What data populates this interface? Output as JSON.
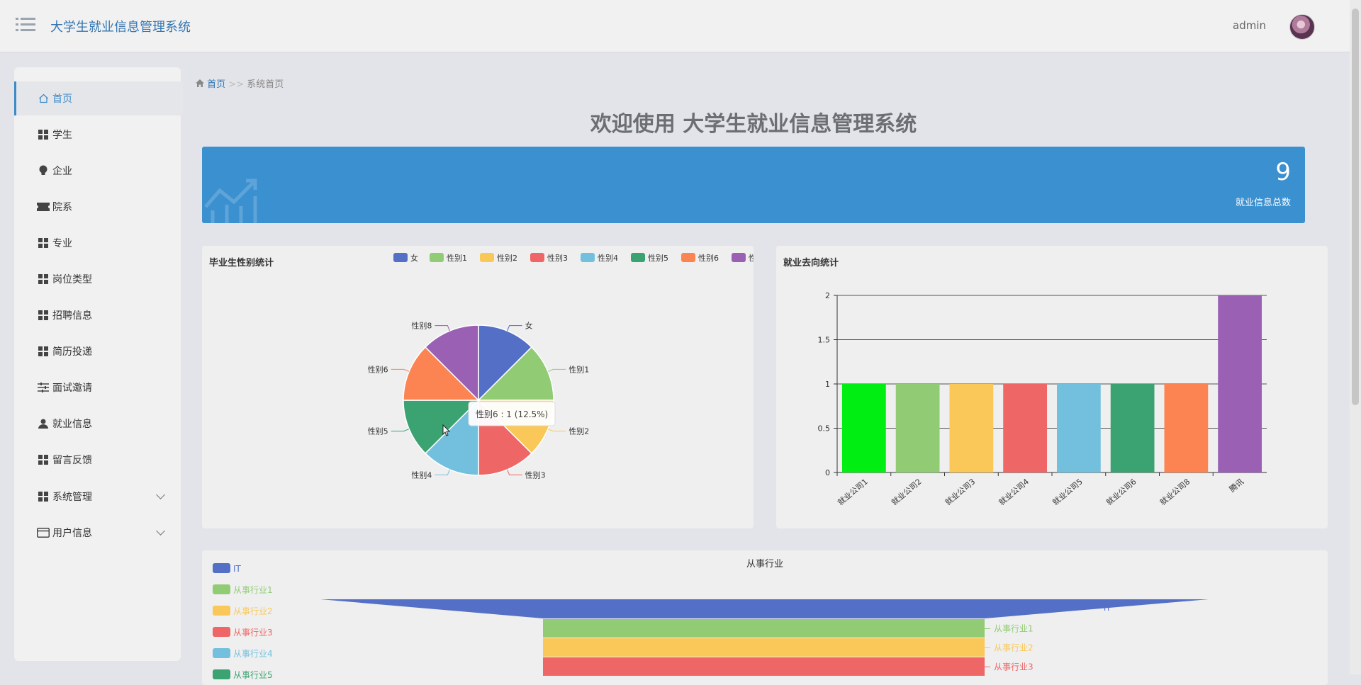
{
  "header": {
    "app_title": "大学生就业信息管理系统",
    "user_name": "admin",
    "menu_icon": "menu-icon"
  },
  "sidebar": {
    "items": [
      {
        "label": "首页",
        "icon": "home-icon",
        "active": true
      },
      {
        "label": "学生",
        "icon": "grid-icon"
      },
      {
        "label": "企业",
        "icon": "bulb-icon"
      },
      {
        "label": "院系",
        "icon": "ticket-icon"
      },
      {
        "label": "专业",
        "icon": "grid-icon"
      },
      {
        "label": "岗位类型",
        "icon": "grid-icon"
      },
      {
        "label": "招聘信息",
        "icon": "grid-icon"
      },
      {
        "label": "简历投递",
        "icon": "grid-icon"
      },
      {
        "label": "面试邀请",
        "icon": "sliders-icon"
      },
      {
        "label": "就业信息",
        "icon": "user-icon"
      },
      {
        "label": "留言反馈",
        "icon": "grid-icon"
      },
      {
        "label": "系统管理",
        "icon": "grid-icon",
        "expandable": true
      },
      {
        "label": "用户信息",
        "icon": "card-icon",
        "expandable": true
      }
    ]
  },
  "breadcrumb": {
    "home": "首页",
    "separator": ">>",
    "current": "系统首页"
  },
  "welcome": "欢迎使用 大学生就业信息管理系统",
  "stat_card": {
    "value": "9",
    "label": "就业信息总数",
    "color": "#3b90d0"
  },
  "chart_data": [
    {
      "type": "pie",
      "title": "毕业生性别统计",
      "labels": [
        "女",
        "性别1",
        "性别2",
        "性别3",
        "性别4",
        "性别5",
        "性别6",
        "性别8"
      ],
      "values": [
        1,
        1,
        1,
        1,
        1,
        1,
        1,
        1
      ],
      "colors": [
        "#5470c6",
        "#91cc75",
        "#fac858",
        "#ee6666",
        "#73c0de",
        "#3ba272",
        "#fc8452",
        "#9a60b4"
      ],
      "legend": "top-right",
      "tooltip": "性别6 : 1 (12.5%)"
    },
    {
      "type": "bar",
      "title": "就业去向统计",
      "categories": [
        "就业公司1",
        "就业公司2",
        "就业公司3",
        "就业公司4",
        "就业公司5",
        "就业公司6",
        "就业公司8",
        "腾讯"
      ],
      "values": [
        1,
        1,
        1,
        1,
        1,
        1,
        1,
        2
      ],
      "colors": [
        "#00ee11",
        "#91cc75",
        "#fac858",
        "#ee6666",
        "#73c0de",
        "#3ba272",
        "#fc8452",
        "#9a60b4"
      ],
      "ylim": [
        0,
        2
      ],
      "yticks": [
        "0",
        "0.5",
        "1",
        "1.5",
        "2"
      ],
      "grid": true
    },
    {
      "type": "funnel",
      "title": "从事行业",
      "legend": [
        "IT",
        "从事行业1",
        "从事行业2",
        "从事行业3",
        "从事行业4",
        "从事行业5"
      ],
      "legend_colors": [
        "#5470c6",
        "#91cc75",
        "#fac858",
        "#ee6666",
        "#73c0de",
        "#3ba272"
      ],
      "visible_stage_labels": [
        "IT",
        "从事行业1",
        "从事行业2",
        "从事行业3"
      ]
    }
  ]
}
